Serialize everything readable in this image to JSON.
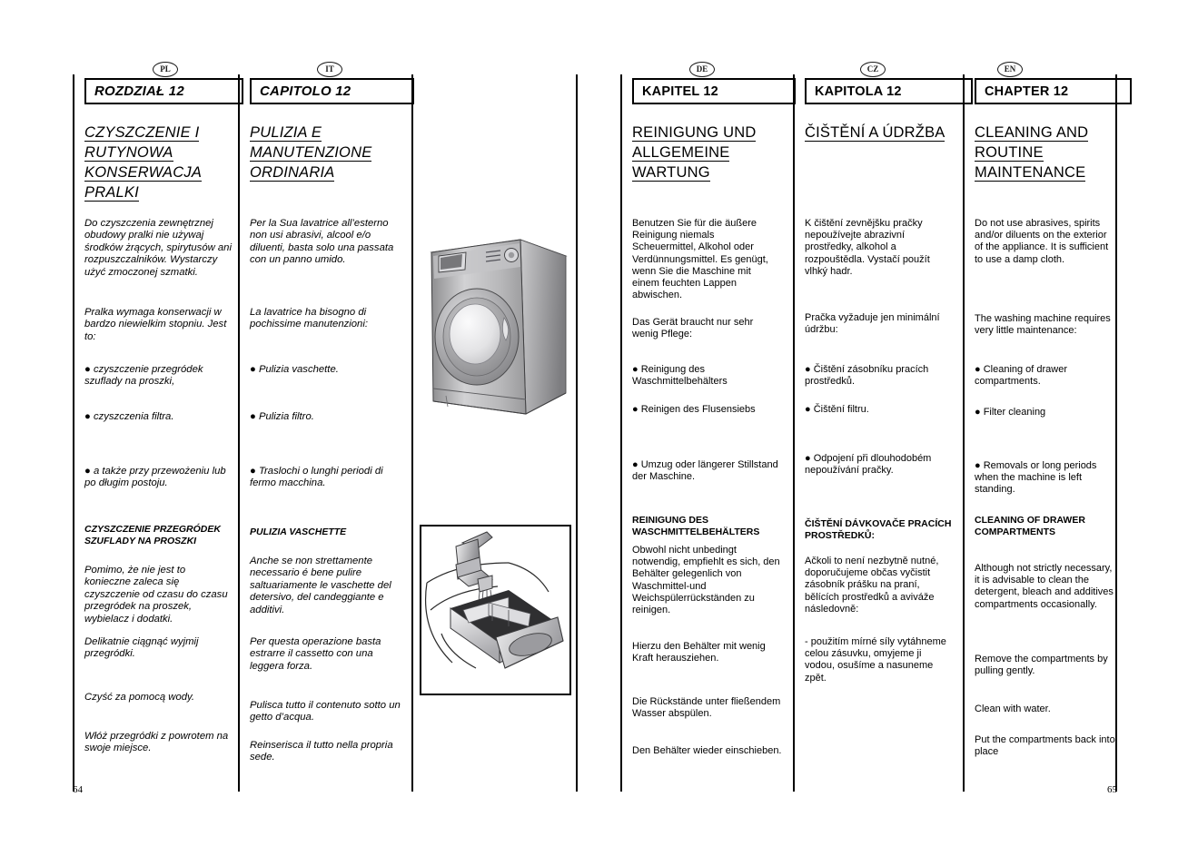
{
  "document": {
    "page_left_number": "64",
    "page_right_number": "65"
  },
  "columns": {
    "pl": {
      "lang_badge": "PL",
      "chapter_box": "ROZDZIAŁ 12",
      "title": "CZYSZCZENIE I RUTYNOWA KONSERWACJA PRALKI",
      "title_lines": [
        "CZYSZCZENIE I",
        "RUTYNOWA",
        "KONSERWACJA",
        "PRALKI"
      ],
      "p1": "Do czyszczenia zewnętrznej obudowy pralki nie używaj środków żrących, spirytusów ani rozpuszczalników. Wystarczy użyć zmoczonej szmatki.",
      "p2": "Pralka wymaga konserwacji w bardzo niewielkim stopniu. Jest to:",
      "b1": "● czyszczenie przegródek szuflady na proszki,",
      "b2": "● czyszczenia filtra.",
      "b3": "● a także przy przewożeniu lub po długim postoju.",
      "sub": "CZYSZCZENIE PRZEGRÓDEK SZUFLADY NA PROSZKI",
      "p3": "Pomimo, że nie jest to konieczne zaleca się czyszczenie od czasu do czasu przegródek na proszek, wybielacz i dodatki.",
      "p4": "Delikatnie ciągnąć wyjmij przegródki.",
      "p5": "Czyść za pomocą wody.",
      "p6": "Włóż przegródki z powrotem na swoje miejsce."
    },
    "it": {
      "lang_badge": "IT",
      "chapter_box": "CAPITOLO 12",
      "title_lines": [
        "PULIZIA E",
        "MANUTENZIONE",
        "ORDINARIA"
      ],
      "p1": "Per la Sua lavatrice all’esterno non usi abrasivi, alcool e/o diluenti, basta solo una passata con un panno umido.",
      "p2": "La lavatrice ha bisogno di pochissime manutenzioni:",
      "b1": "● Pulizia vaschette.",
      "b2": "● Pulizia filtro.",
      "b3": "● Traslochi o lunghi periodi di fermo macchina.",
      "sub": "PULIZIA VASCHETTE",
      "p3": "Anche se non strettamente necessario é bene pulire saltuariamente le vaschette del detersivo, del candeggiante e additivi.",
      "p4": "Per questa operazione basta estrarre il cassetto con una leggera forza.",
      "p5": "Pulisca tutto il contenuto sotto un getto d’acqua.",
      "p6": "Reinserisca il tutto nella propria sede."
    },
    "de": {
      "lang_badge": "DE",
      "chapter_box": "KAPITEL 12",
      "title_lines": [
        "REINIGUNG UND",
        "ALLGEMEINE",
        "WARTUNG"
      ],
      "p1": "Benutzen Sie für die äußere Reinigung niemals Scheuermittel, Alkohol oder Verdünnungsmittel. Es genügt, wenn Sie die Maschine mit einem feuchten Lappen abwischen.",
      "p2": "Das Gerät braucht nur sehr wenig Pflege:",
      "b1": "● Reinigung des Waschmittelbehälters",
      "b2": "● Reinigen des Flusensiebs",
      "b3": "● Umzug oder längerer Stillstand der Maschine.",
      "sub": "REINIGUNG DES WASCHMITTELBEHÄLTERS",
      "p3": "Obwohl nicht unbedingt notwendig, empfiehlt es sich, den Behälter gelegenlich von Waschmittel-und Weichspülerrückständen zu reinigen.",
      "p4": "Hierzu den Behälter mit wenig Kraft herausziehen.",
      "p5": "Die Rückstände unter fließendem Wasser abspülen.",
      "p6": "Den Behälter wieder einschieben."
    },
    "cz": {
      "lang_badge": "CZ",
      "chapter_box": "KAPITOLA 12",
      "title_lines": [
        "ČIŠTĚNÍ A ÚDRŽBA"
      ],
      "p1": "K čištění zevnějšku pračky nepoužívejte abrazivní prostředky, alkohol a rozpouštědla. Vystačí použít vlhký hadr.",
      "p2": "Pračka vyžaduje jen minimální údržbu:",
      "b1": "● Čištění zásobníku  pracích prostředků.",
      "b2": "● Čištění filtru.",
      "b3": "● Odpojení při dlouhodobém nepoužívání pračky.",
      "sub": "ČIŠTĚNÍ DÁVKOVAČE PRACÍCH PROSTŘEDKŮ:",
      "p3": "Ačkoli to není nezbytně nutné, doporučujeme občas vyčistit zásobník  prášku na praní, bělících prostředků a aviváže následovně:",
      "p4": "- použitím mírné síly vytáhneme celou zásuvku, omyjeme ji vodou, osušíme a nasuneme zpět."
    },
    "en": {
      "lang_badge": "EN",
      "chapter_box": "CHAPTER 12",
      "title_lines": [
        "CLEANING AND",
        "ROUTINE",
        "MAINTENANCE"
      ],
      "p1": "Do not use abrasives, spirits and/or diluents on the exterior of the appliance. It is sufficient to use a damp cloth.",
      "p2": "The washing machine requires very little maintenance:",
      "b1": "● Cleaning of drawer compartments.",
      "b2": "● Filter cleaning",
      "b3": "● Removals or long periods when the machine is left standing.",
      "sub": "CLEANING OF DRAWER COMPARTMENTS",
      "p3": "Although not strictly necessary, it is advisable to clean the detergent, bleach and additives compartments occasionally.",
      "p4": "Remove the compartments by pulling gently.",
      "p5": "Clean with water.",
      "p6": "Put the compartments back into place"
    }
  },
  "figures": {
    "washing_machine": "front-loading washing machine, three-quarter view, grey",
    "drawer_rinse": "detergent drawer being rinsed under a running tap"
  }
}
